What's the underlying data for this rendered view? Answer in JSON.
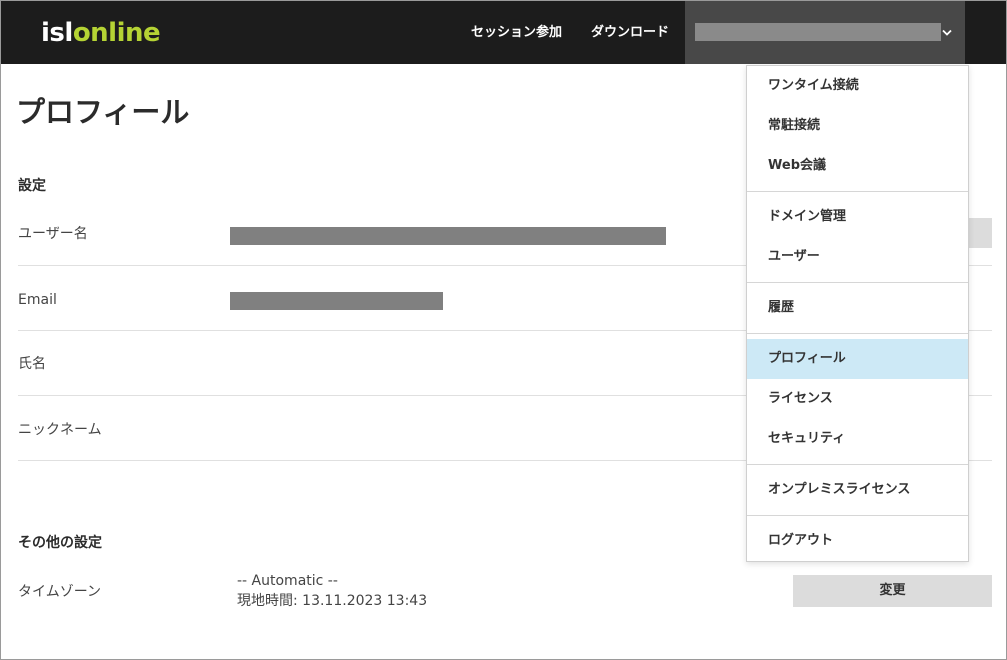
{
  "header": {
    "logo_part1": "isl",
    "logo_part2": "online",
    "nav_join": "セッション参加",
    "nav_download": "ダウンロード",
    "account_chevron": "⌄"
  },
  "page": {
    "title": "プロフィール"
  },
  "settings": {
    "heading": "設定",
    "rows": {
      "username": "ユーザー名",
      "email": "Email",
      "fullname": "氏名",
      "nickname": "ニックネーム"
    }
  },
  "other": {
    "heading": "その他の設定",
    "timezone_label": "タイムゾーン",
    "timezone_value": "-- Automatic --",
    "local_time": "現地時間:  13.11.2023 13:43",
    "change_button": "変更"
  },
  "menu": {
    "items": [
      "ワンタイム接続",
      "常駐接続",
      "Web会議",
      "ドメイン管理",
      "ユーザー",
      "履歴",
      "プロフィール",
      "ライセンス",
      "セキュリティ",
      "オンプレミスライセンス",
      "ログアウト"
    ],
    "active_item": "プロフィール"
  },
  "colors": {
    "header_bg": "#1c1c1c",
    "logo_accent": "#b5d334",
    "menu_active_bg": "#cde9f6",
    "button_bg": "#dcdcdc"
  }
}
